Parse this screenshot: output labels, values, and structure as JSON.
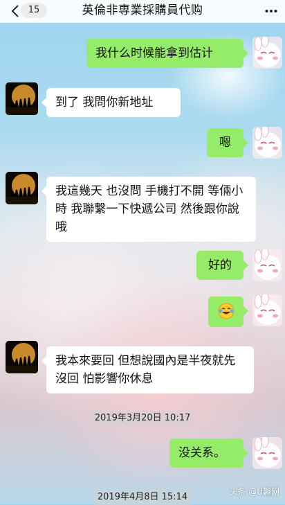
{
  "header": {
    "unread_count": "15",
    "title": "英倫非専業採購員代购"
  },
  "messages": [
    {
      "side": "right",
      "text": "我什么时候能拿到估计"
    },
    {
      "side": "left",
      "text": "到了 我問你新地址"
    },
    {
      "side": "right",
      "text": "嗯"
    },
    {
      "side": "left",
      "text": "我這幾天 也沒問 手機打不開 等倆小時 我聯繫一下快遞公司 然後跟你說哦"
    },
    {
      "side": "right",
      "text": "好的"
    },
    {
      "side": "right",
      "emoji": "😂"
    },
    {
      "side": "left",
      "text": "我本來要回 但想說國內是半夜就先沒回 怕影響你休息"
    },
    {
      "side": "right",
      "text": "没关系。"
    }
  ],
  "timestamps": [
    "2019年3月20日 10:17",
    "2019年4月8日 15:14"
  ],
  "watermark": "头条 @U趣网",
  "colors": {
    "my_bubble": "#95ec69",
    "their_bubble": "#ffffff"
  }
}
